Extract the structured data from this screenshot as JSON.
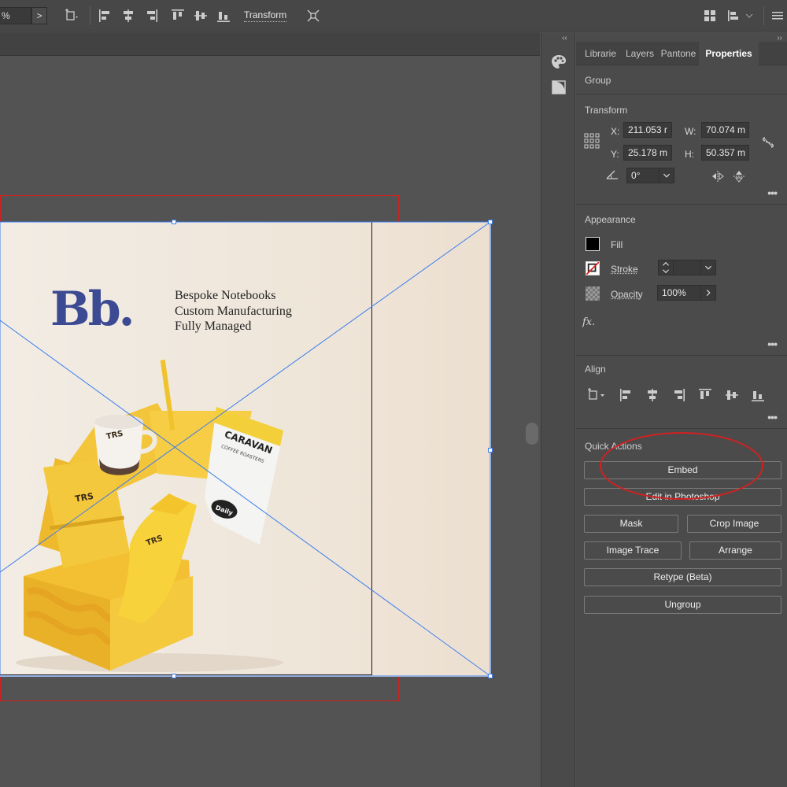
{
  "toolbar": {
    "zoom_value": "%",
    "zoom_arrow": ">",
    "transform_label": "Transform"
  },
  "canvas": {
    "logo_text": "Bb.",
    "tagline": [
      "Bespoke Notebooks",
      "Custom Manufacturing",
      "Fully Managed"
    ]
  },
  "panel": {
    "tabs": [
      {
        "label": "Librarie",
        "active": false
      },
      {
        "label": "Layers",
        "active": false
      },
      {
        "label": "Pantone",
        "active": false
      },
      {
        "label": "Properties",
        "active": true
      }
    ],
    "selection_type": "Group",
    "transform": {
      "title": "Transform",
      "x_label": "X:",
      "x_value": "211.053 r",
      "y_label": "Y:",
      "y_value": "25.178 m",
      "w_label": "W:",
      "w_value": "70.074 m",
      "h_label": "H:",
      "h_value": "50.357 m",
      "angle_value": "0°"
    },
    "appearance": {
      "title": "Appearance",
      "fill_label": "Fill",
      "stroke_label": "Stroke",
      "opacity_label": "Opacity",
      "opacity_value": "100%",
      "fx_label": "fx."
    },
    "align": {
      "title": "Align"
    },
    "quick_actions": {
      "title": "Quick Actions",
      "embed": "Embed",
      "edit_photoshop": "Edit in Photoshop",
      "mask": "Mask",
      "crop_image": "Crop Image",
      "image_trace": "Image Trace",
      "arrange": "Arrange",
      "retype": "Retype (Beta)",
      "ungroup": "Ungroup"
    }
  },
  "colors": {
    "accent_blue": "#3b7cf0",
    "artboard_red": "#d32020",
    "logo_blue": "#3b4a92",
    "annotation_red": "#d42020"
  }
}
